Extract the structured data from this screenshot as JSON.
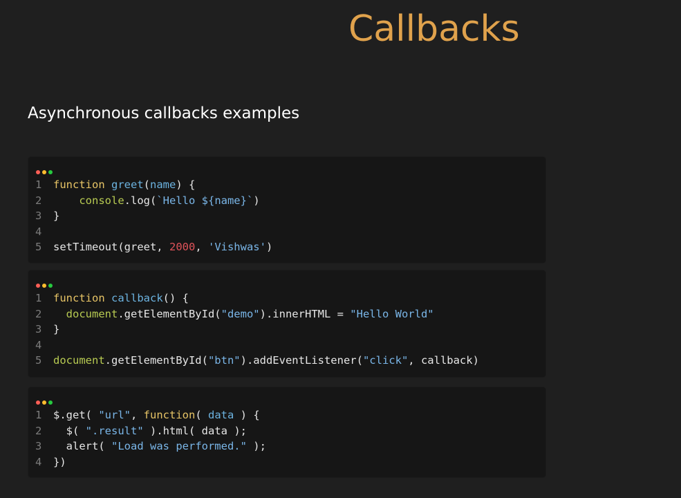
{
  "slide": {
    "title": "Callbacks",
    "subtitle": "Asynchronous callbacks examples"
  },
  "colors": {
    "title": "#e0a24c",
    "background": "#1f1f1f",
    "code_background": "#161616",
    "keyword": "#e7c466",
    "function_name": "#6cb3e0",
    "string": "#7ab6e8",
    "number": "#e0535a",
    "object": "#b8cb52",
    "dot_red": "#ff5f56",
    "dot_yellow": "#ffbd2e",
    "dot_green": "#27c93f"
  },
  "code_blocks": [
    {
      "lines": [
        {
          "n": "1",
          "tokens": [
            {
              "c": "kw",
              "t": "function "
            },
            {
              "c": "fn",
              "t": "greet"
            },
            {
              "c": "pln",
              "t": "("
            },
            {
              "c": "fn",
              "t": "name"
            },
            {
              "c": "pln",
              "t": ") {"
            }
          ]
        },
        {
          "n": "2",
          "tokens": [
            {
              "c": "pln",
              "t": "    "
            },
            {
              "c": "obj",
              "t": "console"
            },
            {
              "c": "pln",
              "t": ".log("
            },
            {
              "c": "str",
              "t": "`Hello ${name}`"
            },
            {
              "c": "pln",
              "t": ")"
            }
          ]
        },
        {
          "n": "3",
          "tokens": [
            {
              "c": "pln",
              "t": "}"
            }
          ]
        },
        {
          "n": "4",
          "tokens": []
        },
        {
          "n": "5",
          "tokens": [
            {
              "c": "pln",
              "t": "setTimeout(greet, "
            },
            {
              "c": "num",
              "t": "2000"
            },
            {
              "c": "pln",
              "t": ", "
            },
            {
              "c": "str",
              "t": "'Vishwas'"
            },
            {
              "c": "pln",
              "t": ")"
            }
          ]
        }
      ]
    },
    {
      "lines": [
        {
          "n": "1",
          "tokens": [
            {
              "c": "kw",
              "t": "function "
            },
            {
              "c": "fn",
              "t": "callback"
            },
            {
              "c": "pln",
              "t": "() {"
            }
          ]
        },
        {
          "n": "2",
          "tokens": [
            {
              "c": "pln",
              "t": "  "
            },
            {
              "c": "obj",
              "t": "document"
            },
            {
              "c": "pln",
              "t": ".getElementById("
            },
            {
              "c": "str",
              "t": "\"demo\""
            },
            {
              "c": "pln",
              "t": ").innerHTML = "
            },
            {
              "c": "str",
              "t": "\"Hello World\""
            }
          ]
        },
        {
          "n": "3",
          "tokens": [
            {
              "c": "pln",
              "t": "}"
            }
          ]
        },
        {
          "n": "4",
          "tokens": []
        },
        {
          "n": "5",
          "tokens": [
            {
              "c": "obj",
              "t": "document"
            },
            {
              "c": "pln",
              "t": ".getElementById("
            },
            {
              "c": "str",
              "t": "\"btn\""
            },
            {
              "c": "pln",
              "t": ").addEventListener("
            },
            {
              "c": "str",
              "t": "\"click\""
            },
            {
              "c": "pln",
              "t": ", callback)"
            }
          ]
        }
      ]
    },
    {
      "lines": [
        {
          "n": "1",
          "tokens": [
            {
              "c": "pln",
              "t": "$.get( "
            },
            {
              "c": "str",
              "t": "\"url\""
            },
            {
              "c": "pln",
              "t": ", "
            },
            {
              "c": "kw",
              "t": "function"
            },
            {
              "c": "pln",
              "t": "( "
            },
            {
              "c": "fn",
              "t": "data"
            },
            {
              "c": "pln",
              "t": " ) {"
            }
          ]
        },
        {
          "n": "2",
          "tokens": [
            {
              "c": "pln",
              "t": "  $( "
            },
            {
              "c": "str",
              "t": "\".result\""
            },
            {
              "c": "pln",
              "t": " ).html( data );"
            }
          ]
        },
        {
          "n": "3",
          "tokens": [
            {
              "c": "pln",
              "t": "  alert( "
            },
            {
              "c": "str",
              "t": "\"Load was performed.\""
            },
            {
              "c": "pln",
              "t": " );"
            }
          ]
        },
        {
          "n": "4",
          "tokens": [
            {
              "c": "pln",
              "t": "})"
            }
          ]
        }
      ]
    }
  ]
}
